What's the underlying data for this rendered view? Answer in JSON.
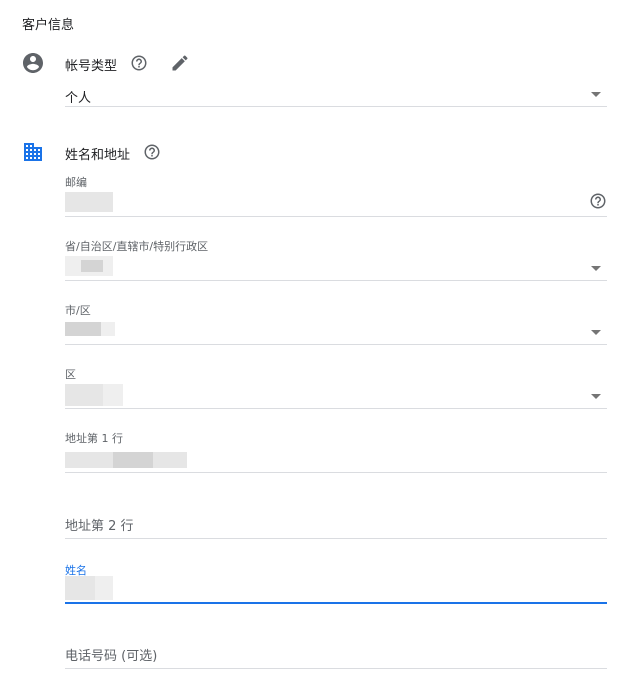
{
  "page_title": "客户信息",
  "account_type": {
    "label": "帐号类型",
    "value": "个人"
  },
  "name_address": {
    "label": "姓名和地址",
    "fields": {
      "postal_code": "邮编",
      "province": "省/自治区/直辖市/特别行政区",
      "city": "市/区",
      "district": "区",
      "address_line1": "地址第 1 行",
      "address_line2": "地址第 2 行",
      "name": "姓名",
      "phone": "电话号码 (可选)"
    }
  },
  "colors": {
    "accent": "#1a73e8",
    "icon_gray": "#5f6368",
    "divider": "#dadce0"
  },
  "icons": [
    "account-circle-icon",
    "help-icon",
    "edit-icon",
    "building-icon",
    "dropdown-caret-icon"
  ]
}
